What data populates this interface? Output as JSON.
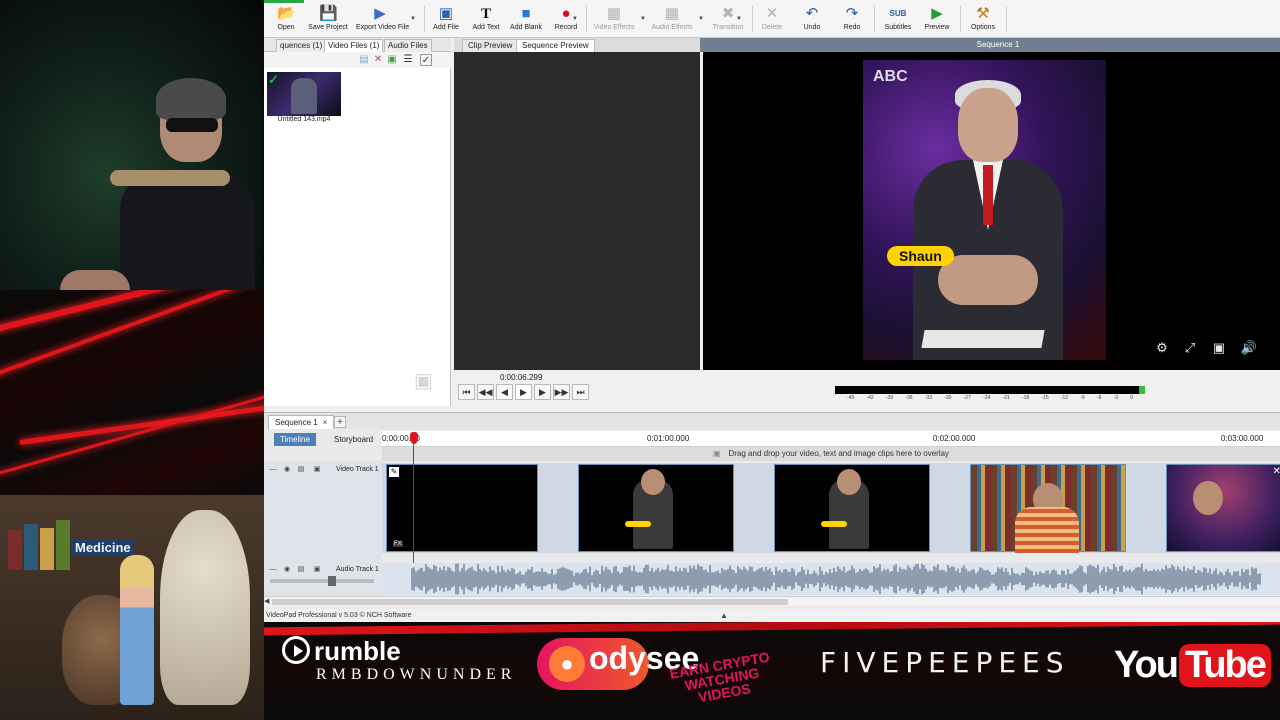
{
  "toolbar": {
    "buttons": [
      {
        "label": "Open",
        "icon": "folder-open-icon"
      },
      {
        "label": "Save Project",
        "icon": "save-icon"
      },
      {
        "label": "Export Video File",
        "icon": "export-icon"
      },
      {
        "label": "Add File",
        "icon": "add-file-icon"
      },
      {
        "label": "Add Text",
        "icon": "add-text-icon"
      },
      {
        "label": "Add Blank",
        "icon": "add-blank-icon"
      },
      {
        "label": "Record",
        "icon": "record-icon"
      },
      {
        "label": "Video Effects",
        "icon": "video-effects-icon"
      },
      {
        "label": "Audio Effects",
        "icon": "audio-effects-icon"
      },
      {
        "label": "Transition",
        "icon": "transition-icon"
      },
      {
        "label": "Delete",
        "icon": "delete-icon"
      },
      {
        "label": "Undo",
        "icon": "undo-icon"
      },
      {
        "label": "Redo",
        "icon": "redo-icon"
      },
      {
        "label": "Subtitles",
        "icon": "subtitles-icon"
      },
      {
        "label": "Preview",
        "icon": "preview-icon"
      },
      {
        "label": "Options",
        "icon": "options-icon"
      }
    ]
  },
  "left_panel": {
    "tabs": [
      "quences (1)",
      "Video Files (1)",
      "Audio Files"
    ],
    "file": {
      "name": "Untitled 143.mp4"
    }
  },
  "preview": {
    "tabs": [
      "Clip Preview",
      "Sequence Preview"
    ],
    "sequence_title": "Sequence 1",
    "name_tag": "Shaun",
    "video_logo": "ABC",
    "time": "0:00:06.299"
  },
  "timeline": {
    "sequence_tab": "Sequence 1",
    "sequence_close": "×",
    "add_tab": "+",
    "view_tabs": [
      "Timeline",
      "Storyboard"
    ],
    "ruler": [
      "0:00:00.00",
      "0:01:00.000",
      "0:02:00.000",
      "0:03:00.000"
    ],
    "overlay_hint": "Drag and drop your video, text and image clips here to overlay",
    "video_track_name": "Video Track 1",
    "audio_track_name": "Audio Track 1",
    "clip_fx": "FX",
    "name_badge": "Shaun"
  },
  "audio_meter": {
    "scale": [
      "-45",
      "-42",
      "-39",
      "-36",
      "-33",
      "-30",
      "-27",
      "-24",
      "-21",
      "-18",
      "-15",
      "-12",
      "-9",
      "-6",
      "-3",
      "0"
    ],
    "level": 0.98
  },
  "status": {
    "text": "VideoPad Professional v 5.03 © NCH Software"
  },
  "overlay": {
    "sign": "Medicine",
    "rumble": "rumble",
    "rumble_handle": "RMBDOWNUNDER",
    "odysee": "odysee",
    "odysee_promo_1": "EARN CRYPTO",
    "odysee_promo_2": "WATCHING VIDEOS",
    "fivepeepees": "FIVEPEEPEES",
    "youtube_you": "You",
    "youtube_tube": "Tube"
  },
  "colors": {
    "accent_blue": "#4d7fb8",
    "playhead": "#e0141b",
    "banner_red": "#e1141c",
    "name_tag": "#ffd200"
  }
}
